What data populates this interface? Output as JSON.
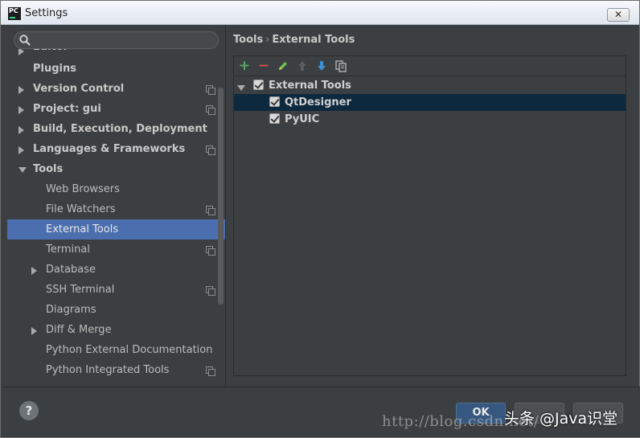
{
  "window": {
    "title": "Settings",
    "logo_text": "PC",
    "close_glyph": "✕"
  },
  "search": {
    "placeholder": "",
    "icon": "search-icon"
  },
  "tree": [
    {
      "label": "Editor",
      "level": 0,
      "arrow": "right",
      "bold": true,
      "project_icon": false,
      "cut": true
    },
    {
      "label": "Plugins",
      "level": 0,
      "arrow": "none",
      "bold": true,
      "project_icon": false
    },
    {
      "label": "Version Control",
      "level": 0,
      "arrow": "right",
      "bold": true,
      "project_icon": true
    },
    {
      "label": "Project: gui",
      "level": 0,
      "arrow": "right",
      "bold": true,
      "project_icon": true
    },
    {
      "label": "Build, Execution, Deployment",
      "level": 0,
      "arrow": "right",
      "bold": true,
      "project_icon": false
    },
    {
      "label": "Languages & Frameworks",
      "level": 0,
      "arrow": "right",
      "bold": true,
      "project_icon": true
    },
    {
      "label": "Tools",
      "level": 0,
      "arrow": "down",
      "bold": true,
      "project_icon": false
    },
    {
      "label": "Web Browsers",
      "level": 1,
      "arrow": "none",
      "bold": false,
      "project_icon": false
    },
    {
      "label": "File Watchers",
      "level": 1,
      "arrow": "none",
      "bold": false,
      "project_icon": true
    },
    {
      "label": "External Tools",
      "level": 1,
      "arrow": "none",
      "bold": false,
      "project_icon": false,
      "selected": true
    },
    {
      "label": "Terminal",
      "level": 1,
      "arrow": "none",
      "bold": false,
      "project_icon": true
    },
    {
      "label": "Database",
      "level": 1,
      "arrow": "right",
      "bold": false,
      "project_icon": false
    },
    {
      "label": "SSH Terminal",
      "level": 1,
      "arrow": "none",
      "bold": false,
      "project_icon": true
    },
    {
      "label": "Diagrams",
      "level": 1,
      "arrow": "none",
      "bold": false,
      "project_icon": false
    },
    {
      "label": "Diff & Merge",
      "level": 1,
      "arrow": "right",
      "bold": false,
      "project_icon": false
    },
    {
      "label": "Python External Documentation",
      "level": 1,
      "arrow": "none",
      "bold": false,
      "project_icon": false
    },
    {
      "label": "Python Integrated Tools",
      "level": 1,
      "arrow": "none",
      "bold": false,
      "project_icon": true
    }
  ],
  "breadcrumb": {
    "parent": "Tools",
    "separator": "›",
    "current": "External Tools"
  },
  "toolbar": {
    "add": {
      "glyph": "+",
      "color": "#59a869",
      "icon": "add-icon"
    },
    "remove": {
      "glyph": "−",
      "color": "#c75450",
      "icon": "remove-icon"
    },
    "edit": {
      "glyph": "✎",
      "color": "#6fbf4c",
      "icon": "edit-icon"
    },
    "up": {
      "glyph": "↑",
      "color": "#5c5c5c",
      "icon": "move-up-icon"
    },
    "down": {
      "glyph": "↓",
      "color": "#3d8fd1",
      "icon": "move-down-icon"
    },
    "copy": {
      "glyph": "⧉",
      "color": "#afb1b3",
      "icon": "copy-icon"
    }
  },
  "tools_tree": {
    "group": {
      "label": "External Tools",
      "checked": true
    },
    "items": [
      {
        "label": "QtDesigner",
        "checked": true,
        "selected": true
      },
      {
        "label": "PyUIC",
        "checked": true,
        "selected": false
      }
    ]
  },
  "footer": {
    "help": "?",
    "ok": "OK",
    "cancel": "",
    "apply": ""
  },
  "watermark": {
    "url": "http://blog.csdn.net/",
    "brand": "头条 @Java识堂"
  }
}
